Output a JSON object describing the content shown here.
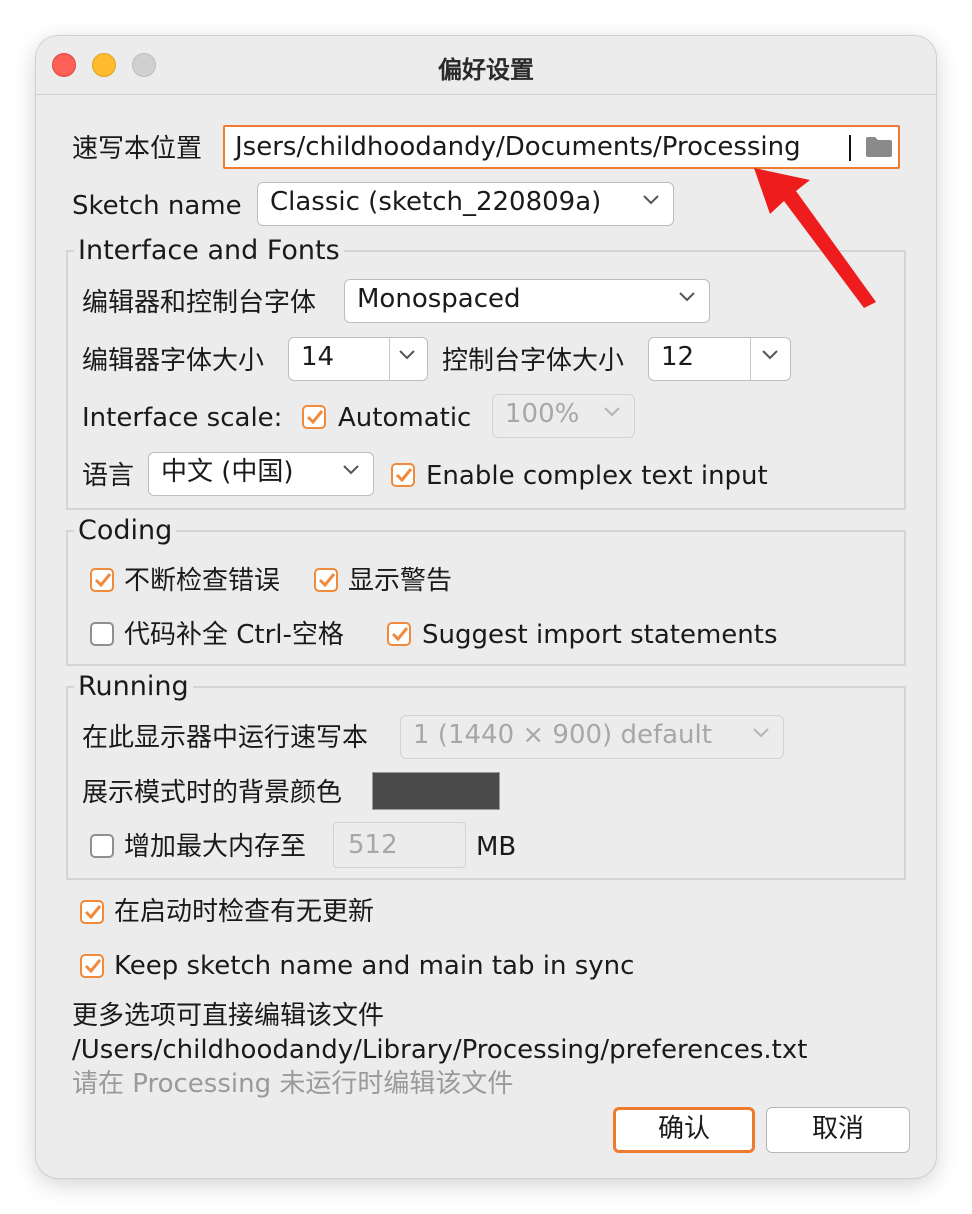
{
  "window": {
    "title": "偏好设置"
  },
  "sketchbook": {
    "label": "速写本位置",
    "path": "Jsers/childhoodandy/Documents/Processing",
    "browse_icon": "folder-icon"
  },
  "sketch_name": {
    "label": "Sketch name",
    "value": "Classic (sketch_220809a)"
  },
  "interface_fonts": {
    "legend": "Interface and Fonts",
    "editor_font_label": "编辑器和控制台字体",
    "editor_font_value": "Monospaced",
    "editor_size_label": "编辑器字体大小",
    "editor_size_value": "14",
    "console_size_label": "控制台字体大小",
    "console_size_value": "12",
    "scale_label": "Interface scale:",
    "scale_auto_label": "Automatic",
    "scale_auto_checked": true,
    "scale_value": "100%",
    "language_label": "语言",
    "language_value": "中文 (中国)",
    "complex_input_label": "Enable complex text input",
    "complex_input_checked": true
  },
  "coding": {
    "legend": "Coding",
    "continuous_check_label": "不断检查错误",
    "continuous_check_checked": true,
    "show_warnings_label": "显示警告",
    "show_warnings_checked": true,
    "completion_label": "代码补全 Ctrl-空格",
    "completion_checked": false,
    "suggest_imports_label": "Suggest import statements",
    "suggest_imports_checked": true
  },
  "running": {
    "legend": "Running",
    "display_label": "在此显示器中运行速写本",
    "display_value": "1 (1440 × 900) default",
    "bg_color_label": "展示模式时的背景颜色",
    "bg_color": "#4a4a4a",
    "max_memory_label": "增加最大内存至",
    "max_memory_checked": false,
    "max_memory_value": "512",
    "memory_unit": "MB"
  },
  "startup_check_label": "在启动时检查有无更新",
  "startup_check_checked": true,
  "sync_label": "Keep sketch name and main tab in sync",
  "sync_checked": true,
  "footer": {
    "more_options": "更多选项可直接编辑该文件",
    "prefs_path": "/Users/childhoodandy/Library/Processing/preferences.txt",
    "note": "请在 Processing 未运行时编辑该文件"
  },
  "buttons": {
    "ok": "确认",
    "cancel": "取消"
  },
  "colors": {
    "accent": "#f08a3c",
    "annotation_arrow": "#ee1c1c"
  }
}
